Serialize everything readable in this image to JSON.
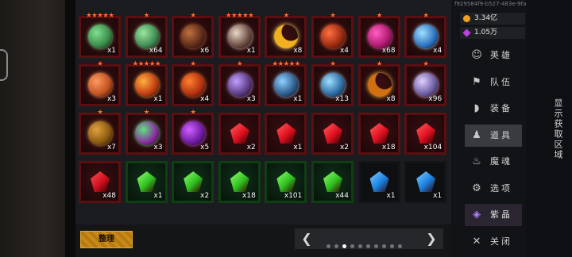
{
  "session_id": "f929584f9-b527-483e-9fac",
  "currencies": [
    {
      "icon": "gold-coin-icon",
      "value": "3.34亿",
      "color": "#f0a020"
    },
    {
      "icon": "purple-gem-icon",
      "value": "1.05万",
      "color": "#c040e0"
    }
  ],
  "menu": [
    {
      "label": "英雄",
      "icon": "hero-icon"
    },
    {
      "label": "队伍",
      "icon": "flag-icon"
    },
    {
      "label": "装备",
      "icon": "helmet-icon"
    },
    {
      "label": "道具",
      "icon": "bag-icon",
      "active": true
    },
    {
      "label": "魔魂",
      "icon": "flame-icon"
    },
    {
      "label": "选项",
      "icon": "gear-icon"
    },
    {
      "label": "紫晶",
      "icon": "crystal-icon",
      "special": true
    },
    {
      "label": "关闭",
      "icon": "close-icon"
    }
  ],
  "side_label": "显示获取区域",
  "sort_button": "整理",
  "pager": {
    "pages": 10,
    "current": 3,
    "prev": "❮",
    "next": "❯"
  },
  "items": [
    {
      "row": 0,
      "col": 0,
      "stars": "★★★★★",
      "qty": "x1",
      "kind": "orb",
      "color": "#3a8a4a",
      "glow": "#7fe08f"
    },
    {
      "row": 0,
      "col": 1,
      "stars": "★",
      "qty": "x64",
      "kind": "orb",
      "color": "#3e8a52",
      "glow": "#9be8a0"
    },
    {
      "row": 0,
      "col": 2,
      "stars": "★",
      "qty": "x6",
      "kind": "orb",
      "color": "#5a2a18",
      "glow": "#c07040"
    },
    {
      "row": 0,
      "col": 3,
      "stars": "★★★★★",
      "qty": "x1",
      "kind": "orb",
      "color": "#6a4a40",
      "glow": "#e8d8c8"
    },
    {
      "row": 0,
      "col": 4,
      "stars": "★",
      "qty": "x8",
      "kind": "moon",
      "color": "#f0b020",
      "glow": "#ffe070"
    },
    {
      "row": 0,
      "col": 5,
      "stars": "★",
      "qty": "x4",
      "kind": "orb",
      "color": "#9a2a10",
      "glow": "#ff7040"
    },
    {
      "row": 0,
      "col": 6,
      "stars": "★",
      "qty": "x68",
      "kind": "orb",
      "color": "#b01870",
      "glow": "#ff60c0"
    },
    {
      "row": 0,
      "col": 7,
      "stars": "★",
      "qty": "x4",
      "kind": "orb",
      "color": "#2a70c0",
      "glow": "#a0e0ff"
    },
    {
      "row": 1,
      "col": 0,
      "stars": "★",
      "qty": "x3",
      "kind": "orb",
      "color": "#c05020",
      "glow": "#ff9a60"
    },
    {
      "row": 1,
      "col": 1,
      "stars": "★★★★★",
      "qty": "x1",
      "kind": "orb",
      "color": "#c03a10",
      "glow": "#ffb040"
    },
    {
      "row": 1,
      "col": 2,
      "stars": "★",
      "qty": "x4",
      "kind": "orb",
      "color": "#b03010",
      "glow": "#ff8030"
    },
    {
      "row": 1,
      "col": 3,
      "stars": "★",
      "qty": "x3",
      "kind": "orb",
      "color": "#5a3a80",
      "glow": "#c0a0ff"
    },
    {
      "row": 1,
      "col": 4,
      "stars": "★★★★★",
      "qty": "x1",
      "kind": "orb",
      "color": "#2a5a8a",
      "glow": "#90d0ff"
    },
    {
      "row": 1,
      "col": 5,
      "stars": "★",
      "qty": "x13",
      "kind": "orb",
      "color": "#2a6aa0",
      "glow": "#a0e0ff"
    },
    {
      "row": 1,
      "col": 6,
      "stars": "★",
      "qty": "x8",
      "kind": "moon",
      "color": "#d07010",
      "glow": "#ffc040"
    },
    {
      "row": 1,
      "col": 7,
      "stars": "★",
      "qty": "x96",
      "kind": "orb",
      "color": "#6a5aa0",
      "glow": "#e0d0ff"
    },
    {
      "row": 2,
      "col": 0,
      "stars": "★",
      "qty": "x7",
      "kind": "orb",
      "color": "#8a5a10",
      "glow": "#e0a040"
    },
    {
      "row": 2,
      "col": 1,
      "stars": "★",
      "qty": "x3",
      "kind": "orb",
      "color": "#8a2aa0",
      "glow": "#60e080"
    },
    {
      "row": 2,
      "col": 2,
      "stars": "★",
      "qty": "x5",
      "kind": "orb",
      "color": "#6a1aa0",
      "glow": "#d060ff"
    },
    {
      "row": 2,
      "col": 3,
      "stars": "",
      "qty": "x2",
      "kind": "gem",
      "color": "#e01020",
      "glow": "#ff6060"
    },
    {
      "row": 2,
      "col": 4,
      "stars": "",
      "qty": "x1",
      "kind": "gem",
      "color": "#e01020",
      "glow": "#ff6060"
    },
    {
      "row": 2,
      "col": 5,
      "stars": "",
      "qty": "x2",
      "kind": "gem",
      "color": "#e01020",
      "glow": "#ff6060"
    },
    {
      "row": 2,
      "col": 6,
      "stars": "",
      "qty": "x18",
      "kind": "gem",
      "color": "#e01020",
      "glow": "#ff6060"
    },
    {
      "row": 2,
      "col": 7,
      "stars": "",
      "qty": "x104",
      "kind": "gem",
      "color": "#e01020",
      "glow": "#ff6060"
    },
    {
      "row": 3,
      "col": 0,
      "stars": "",
      "qty": "x48",
      "kind": "gem",
      "color": "#d01020",
      "glow": "#ff5050"
    },
    {
      "row": 3,
      "col": 1,
      "stars": "",
      "qty": "x1",
      "kind": "gem",
      "color": "#30c020",
      "glow": "#90ff70",
      "slot": "green"
    },
    {
      "row": 3,
      "col": 2,
      "stars": "",
      "qty": "x2",
      "kind": "gem",
      "color": "#30c020",
      "glow": "#90ff70",
      "slot": "green"
    },
    {
      "row": 3,
      "col": 3,
      "stars": "",
      "qty": "x18",
      "kind": "gem",
      "color": "#30c020",
      "glow": "#90ff70",
      "slot": "green"
    },
    {
      "row": 3,
      "col": 4,
      "stars": "",
      "qty": "x101",
      "kind": "gem",
      "color": "#30c020",
      "glow": "#90ff70",
      "slot": "green"
    },
    {
      "row": 3,
      "col": 5,
      "stars": "",
      "qty": "x44",
      "kind": "gem",
      "color": "#30c020",
      "glow": "#90ff70",
      "slot": "green"
    },
    {
      "row": 3,
      "col": 6,
      "stars": "",
      "qty": "x1",
      "kind": "gem",
      "color": "#1a80e0",
      "glow": "#80d0ff",
      "slot": "dark"
    },
    {
      "row": 3,
      "col": 7,
      "stars": "",
      "qty": "x1",
      "kind": "gem",
      "color": "#1a80e0",
      "glow": "#80d0ff",
      "slot": "dark"
    }
  ]
}
